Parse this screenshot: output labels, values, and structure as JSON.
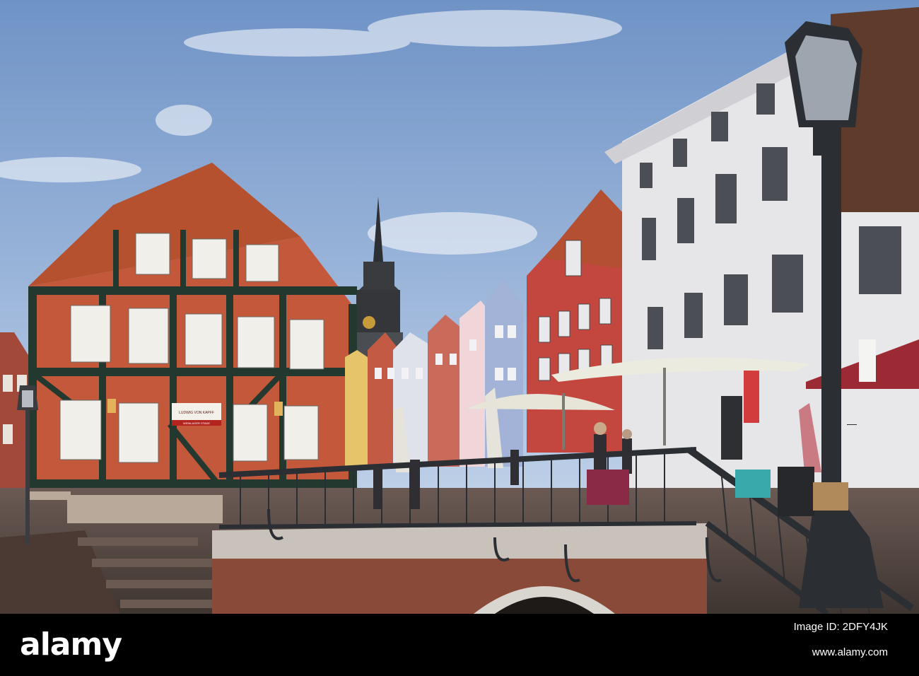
{
  "photo": {
    "subject": "old town harbour street with half-timbered houses, church spire, bridge railing and cafe umbrellas",
    "colors": {
      "sky_top": "#7a9ccc",
      "sky_bottom": "#c8d8ec",
      "timber_red": "#c4583a",
      "timber_beams": "#23382f",
      "roof_tile": "#b44f32",
      "white_building": "#e6e6e8",
      "brick": "#8a4a3a",
      "railing": "#2b2e33"
    },
    "sign_text": "LUDWIG VON KAPFF",
    "sign_subtext": "WEINLAGER STADE"
  },
  "watermark": {
    "logo": "alamy",
    "image_id": "Image ID: 2DFY4JK",
    "url": "www.alamy.com"
  }
}
